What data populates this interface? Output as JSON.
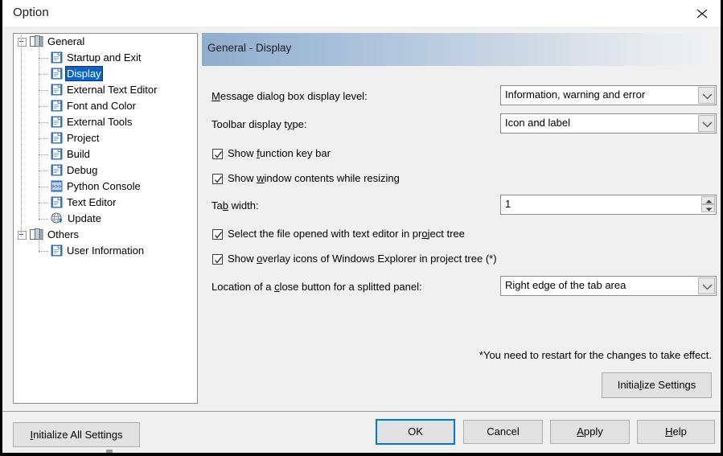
{
  "window": {
    "title": "Option",
    "close_icon": "close-icon"
  },
  "tree": {
    "items": [
      {
        "label": "General",
        "level": 0,
        "icon": "folder-icon",
        "expander": "minus",
        "selected": false
      },
      {
        "label": "Startup and Exit",
        "level": 1,
        "icon": "page-icon",
        "expander": "",
        "selected": false
      },
      {
        "label": "Display",
        "level": 1,
        "icon": "page-icon",
        "expander": "",
        "selected": true
      },
      {
        "label": "External Text Editor",
        "level": 1,
        "icon": "page-icon",
        "expander": "",
        "selected": false
      },
      {
        "label": "Font and Color",
        "level": 1,
        "icon": "page-icon",
        "expander": "",
        "selected": false
      },
      {
        "label": "External Tools",
        "level": 1,
        "icon": "page-icon",
        "expander": "",
        "selected": false
      },
      {
        "label": "Project",
        "level": 1,
        "icon": "page-icon",
        "expander": "",
        "selected": false
      },
      {
        "label": "Build",
        "level": 1,
        "icon": "page-icon",
        "expander": "",
        "selected": false
      },
      {
        "label": "Debug",
        "level": 1,
        "icon": "page-icon",
        "expander": "",
        "selected": false
      },
      {
        "label": "Python Console",
        "level": 1,
        "icon": "python-console-icon",
        "expander": "",
        "selected": false
      },
      {
        "label": "Text Editor",
        "level": 1,
        "icon": "page-icon",
        "expander": "",
        "selected": false
      },
      {
        "label": "Update",
        "level": 1,
        "icon": "update-globe-icon",
        "expander": "",
        "selected": false
      },
      {
        "label": "Others",
        "level": 0,
        "icon": "folder-icon",
        "expander": "minus",
        "selected": false
      },
      {
        "label": "User Information",
        "level": 1,
        "icon": "page-icon",
        "expander": "",
        "selected": false
      }
    ]
  },
  "pane": {
    "header_title": "General - Display",
    "fields": {
      "message_level": {
        "label_pre": "",
        "label_accel": "M",
        "label_post": "essage dialog box display level:",
        "value": "Information, warning and error"
      },
      "toolbar_type": {
        "label_pre": "Toolbar display t",
        "label_accel": "y",
        "label_post": "pe:",
        "value": "Icon and label"
      },
      "tab_width": {
        "label_pre": "Ta",
        "label_accel": "b",
        "label_post": " width:",
        "value": "1"
      },
      "close_button_location": {
        "label_pre": "Location of a ",
        "label_accel": "c",
        "label_post": "lose button for a splitted panel:",
        "value": "Right edge of the tab area"
      }
    },
    "checkboxes": [
      {
        "pre": "Show ",
        "accel": "f",
        "post": "unction key bar",
        "checked": true
      },
      {
        "pre": "Show ",
        "accel": "w",
        "post": "indow contents while resizing",
        "checked": true
      },
      {
        "pre": "Select the file opened with text editor in pr",
        "accel": "o",
        "post": "ject tree",
        "checked": true
      },
      {
        "pre": "Show ",
        "accel": "o",
        "post": "verlay icons of Windows Explorer in project tree (*)",
        "checked": true
      }
    ],
    "restart_note": "*You need to restart for the changes to take effect.",
    "initialize_settings": {
      "pre": "Initia",
      "accel": "l",
      "post": "ize Settings"
    }
  },
  "footer": {
    "initialize_all": {
      "pre": "",
      "accel": "I",
      "post": "nitialize All Settings"
    },
    "ok": {
      "pre": "OK",
      "accel": "",
      "post": ""
    },
    "cancel": {
      "pre": "Cancel",
      "accel": "",
      "post": ""
    },
    "apply": {
      "pre": "",
      "accel": "A",
      "post": "pply"
    },
    "help": {
      "pre": "",
      "accel": "H",
      "post": "elp"
    }
  },
  "colors": {
    "accent": "#0078d7",
    "selection": "#0a64c8",
    "header_gradient_start": "#8fadcf",
    "header_gradient_end": "#eff1f3",
    "dialog_bg": "#f0f0f0"
  }
}
